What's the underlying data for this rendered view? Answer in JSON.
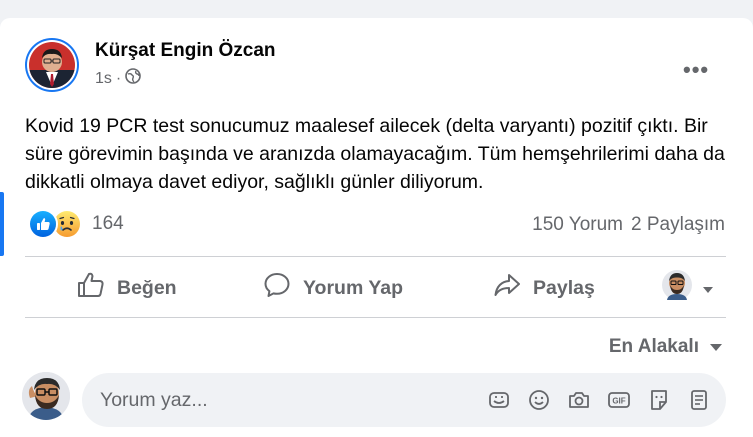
{
  "post": {
    "author": "Kürşat Engin Özcan",
    "time": "1s",
    "separator": "·",
    "more": "•••",
    "text": "Kovid 19 PCR test sonucumuz maalesef ailecek (delta varyantı) pozitif çıktı. Bir süre görevimin başında ve aranızda olamayacağım. Tüm hemşehrilerimi daha da dikkatli olmaya davet ediyor, sağlıklı günler diliyorum.",
    "reaction_count": "164",
    "comments_count": "150 Yorum",
    "shares_count": "2 Paylaşım"
  },
  "actions": {
    "like": "Beğen",
    "comment": "Yorum Yap",
    "share": "Paylaş"
  },
  "comments": {
    "sort_label": "En Alakalı",
    "placeholder": "Yorum yaz..."
  },
  "colors": {
    "accent": "#1877f2",
    "text": "#050505",
    "secondary": "#65676b",
    "background": "#f0f2f5"
  },
  "icons": [
    "globe-icon",
    "more-icon",
    "like-reaction-icon",
    "sad-reaction-icon",
    "thumbs-up-icon",
    "comment-icon",
    "share-icon",
    "profile-switch-avatar",
    "chevron-down-icon",
    "sticker-icon",
    "emoji-icon",
    "camera-icon",
    "gif-icon",
    "avatar-sticker-icon",
    "note-icon"
  ]
}
